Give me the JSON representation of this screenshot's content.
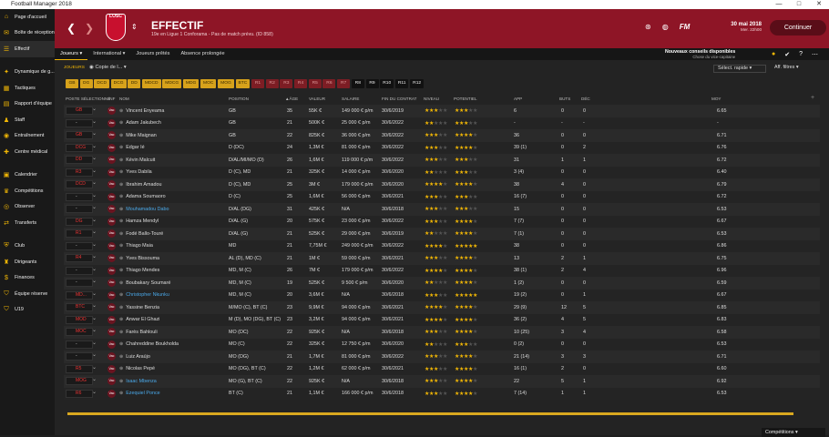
{
  "window": {
    "title": "Football Manager 2018",
    "controls": [
      "—",
      "□",
      "✕"
    ]
  },
  "sidebar": {
    "items": [
      {
        "label": "Page d'accueil",
        "icon": "home-icon",
        "glyph": "⌂"
      },
      {
        "label": "Boîte de réception",
        "icon": "mail-icon",
        "glyph": "✉"
      },
      {
        "label": "Effectif",
        "icon": "squad-icon",
        "glyph": "☰",
        "active": true
      },
      {
        "label": "Dynamique de g...",
        "icon": "dynamics-icon",
        "glyph": "✦"
      },
      {
        "label": "Tactiques",
        "icon": "tactics-icon",
        "glyph": "▦"
      },
      {
        "label": "Rapport d'équipe",
        "icon": "report-icon",
        "glyph": "▤"
      },
      {
        "label": "Staff",
        "icon": "staff-icon",
        "glyph": "♟"
      },
      {
        "label": "Entraînement",
        "icon": "training-icon",
        "glyph": "◉"
      },
      {
        "label": "Centre médical",
        "icon": "medical-icon",
        "glyph": "✚"
      },
      {
        "label": "Calendrier",
        "icon": "calendar-icon",
        "glyph": "▣"
      },
      {
        "label": "Compétitions",
        "icon": "trophy-icon",
        "glyph": "♛"
      },
      {
        "label": "Observer",
        "icon": "scout-icon",
        "glyph": "◎"
      },
      {
        "label": "Transferts",
        "icon": "transfer-icon",
        "glyph": "⇄"
      },
      {
        "label": "Club",
        "icon": "club-icon",
        "glyph": "⛨"
      },
      {
        "label": "Dirigeants",
        "icon": "board-icon",
        "glyph": "♜"
      },
      {
        "label": "Finances",
        "icon": "finance-icon",
        "glyph": "$"
      },
      {
        "label": "Équipe réserve",
        "icon": "reserve-icon",
        "glyph": "⛉"
      },
      {
        "label": "U19",
        "icon": "youth-icon",
        "glyph": "⛉"
      }
    ]
  },
  "header": {
    "crest_text": "LOSC",
    "title": "EFFECTIF",
    "subtitle": "19e en Ligue 1 Conforama - Pas de match prévu. (ID 858)",
    "date": "30 mai 2018",
    "time": "Mer. 22h00",
    "continue_label": "Continuer",
    "advice_title": "Nouveaux conseils disponibles",
    "advice_sub": "Chose du vice-capitaine"
  },
  "subnav": {
    "tabs": [
      "Joueurs ▾",
      "International ▾",
      "Joueurs prêtés",
      "Absence prolongée"
    ]
  },
  "controls": {
    "players_label": "JOUEURS",
    "view_select": "Copie de l...",
    "quick_select": "Sélect. rapide",
    "filter_label": "Aff. filtres"
  },
  "chips": [
    {
      "t": "GB",
      "c": "y"
    },
    {
      "t": "DG",
      "c": "y"
    },
    {
      "t": "DCD",
      "c": "y"
    },
    {
      "t": "DCG",
      "c": "y"
    },
    {
      "t": "DD",
      "c": "y"
    },
    {
      "t": "MDCD",
      "c": "y"
    },
    {
      "t": "MDCG",
      "c": "y"
    },
    {
      "t": "MDG",
      "c": "y"
    },
    {
      "t": "MOC",
      "c": "y"
    },
    {
      "t": "MOG",
      "c": "y"
    },
    {
      "t": "BTC",
      "c": "y"
    },
    {
      "t": "R1",
      "c": "r"
    },
    {
      "t": "R2",
      "c": "r"
    },
    {
      "t": "R3",
      "c": "r"
    },
    {
      "t": "R4",
      "c": "r"
    },
    {
      "t": "R5",
      "c": "r"
    },
    {
      "t": "R6",
      "c": "r"
    },
    {
      "t": "R7",
      "c": "r"
    },
    {
      "t": "R8",
      "c": "k"
    },
    {
      "t": "R9",
      "c": "k"
    },
    {
      "t": "R10",
      "c": "k"
    },
    {
      "t": "R11",
      "c": "k"
    },
    {
      "t": "R12",
      "c": "k"
    }
  ],
  "columns": [
    "POSTE SÉLECTIONNÉ",
    "INF",
    "NOM",
    "POSITION",
    "▲ÂGE",
    "VALEUR",
    "SALAIRE",
    "FIN DU CONTRAT",
    "NIVEAU",
    "POTENTIEL",
    "APP",
    "BUTS",
    "DÉC",
    "MOY"
  ],
  "players": [
    {
      "sel": "GB",
      "name": "Vincent Enyeama",
      "pos": "GB",
      "age": "35",
      "value": "55K €",
      "wage": "149 000 € p/m",
      "contract": "30/6/2019",
      "lvl": 2.5,
      "pot": 2.5,
      "app": "6",
      "goals": "0",
      "dec": "0",
      "avg": "6.65"
    },
    {
      "sel": "-",
      "name": "Adam Jakubech",
      "pos": "GB",
      "age": "21",
      "value": "500K €",
      "wage": "25 000 € p/m",
      "contract": "30/6/2022",
      "lvl": 2,
      "pot": 3,
      "app": "-",
      "goals": "-",
      "dec": "-",
      "avg": "-"
    },
    {
      "sel": "GB",
      "name": "Mike Maignan",
      "pos": "GB",
      "age": "22",
      "value": "825K €",
      "wage": "36 000 € p/m",
      "contract": "30/6/2022",
      "lvl": 2.5,
      "pot": 4,
      "app": "36",
      "goals": "0",
      "dec": "0",
      "avg": "6.71"
    },
    {
      "sel": "DCG",
      "name": "Edgar Ié",
      "pos": "D (DC)",
      "age": "24",
      "value": "1,3M €",
      "wage": "81 000 € p/m",
      "contract": "30/6/2022",
      "lvl": 3,
      "pot": 3.5,
      "app": "39 (1)",
      "goals": "0",
      "dec": "2",
      "avg": "6.76"
    },
    {
      "sel": "DD",
      "name": "Kévin Malcuit",
      "pos": "D/AL/MI/MO (D)",
      "age": "26",
      "value": "1,6M €",
      "wage": "119 000 € p/m",
      "contract": "30/6/2022",
      "lvl": 3,
      "pot": 3,
      "app": "31",
      "goals": "1",
      "dec": "1",
      "avg": "6.72"
    },
    {
      "sel": "R3",
      "name": "Yves Dabila",
      "pos": "D (C), MD",
      "age": "21",
      "value": "325K €",
      "wage": "14 000 € p/m",
      "contract": "30/6/2020",
      "lvl": 2,
      "pot": 3,
      "app": "3 (4)",
      "goals": "0",
      "dec": "0",
      "avg": "6.40"
    },
    {
      "sel": "DCD",
      "name": "Ibrahim Amadou",
      "pos": "D (C), MD",
      "age": "25",
      "value": "3M €",
      "wage": "179 000 € p/m",
      "contract": "30/6/2020",
      "lvl": 3.5,
      "pot": 3.5,
      "app": "38",
      "goals": "4",
      "dec": "0",
      "avg": "6.79"
    },
    {
      "sel": "-",
      "name": "Adama Soumaoro",
      "pos": "D (C)",
      "age": "25",
      "value": "1,6M €",
      "wage": "56 000 € p/m",
      "contract": "30/6/2021",
      "lvl": 3,
      "pot": 3,
      "app": "16 (7)",
      "goals": "0",
      "dec": "0",
      "avg": "6.72"
    },
    {
      "sel": "-",
      "name": "Mouhamadou Dabo",
      "pos": "D/AL (DG)",
      "age": "31",
      "value": "425K €",
      "wage": "N/A",
      "contract": "30/6/2018",
      "lvl": 2.5,
      "pot": 2.5,
      "app": "15",
      "goals": "0",
      "dec": "0",
      "avg": "6.53",
      "loan": true
    },
    {
      "sel": "DG",
      "name": "Hamza Mendyl",
      "pos": "D/AL (G)",
      "age": "20",
      "value": "575K €",
      "wage": "23 000 € p/m",
      "contract": "30/6/2022",
      "lvl": 2.5,
      "pot": 4,
      "app": "7 (7)",
      "goals": "0",
      "dec": "0",
      "avg": "6.67"
    },
    {
      "sel": "R1",
      "name": "Fodé Ballo-Touré",
      "pos": "D/AL (G)",
      "age": "21",
      "value": "525K €",
      "wage": "29 000 € p/m",
      "contract": "30/6/2019",
      "lvl": 2,
      "pot": 3.5,
      "app": "7 (1)",
      "goals": "0",
      "dec": "0",
      "avg": "6.53"
    },
    {
      "sel": "-",
      "name": "Thiago Maia",
      "pos": "MD",
      "age": "21",
      "value": "7,75M €",
      "wage": "249 000 € p/m",
      "contract": "30/6/2022",
      "lvl": 3.5,
      "pot": 4.5,
      "app": "38",
      "goals": "0",
      "dec": "0",
      "avg": "6.86"
    },
    {
      "sel": "R4",
      "name": "Yves Bissouma",
      "pos": "AL (D), MD (C)",
      "age": "21",
      "value": "1M €",
      "wage": "59 000 € p/m",
      "contract": "30/6/2021",
      "lvl": 3,
      "pot": 4,
      "app": "13",
      "goals": "2",
      "dec": "1",
      "avg": "6.75"
    },
    {
      "sel": "-",
      "name": "Thiago Mendes",
      "pos": "MD, M (C)",
      "age": "26",
      "value": "7M €",
      "wage": "179 000 € p/m",
      "contract": "30/6/2022",
      "lvl": 4,
      "pot": 4,
      "app": "38 (1)",
      "goals": "2",
      "dec": "4",
      "avg": "6.96"
    },
    {
      "sel": "-",
      "name": "Boubakary Soumaré",
      "pos": "MD, M (C)",
      "age": "19",
      "value": "525K €",
      "wage": "9 500 € p/m",
      "contract": "30/6/2020",
      "lvl": 2,
      "pot": 4,
      "app": "1 (2)",
      "goals": "0",
      "dec": "0",
      "avg": "6.59"
    },
    {
      "sel": "MD...",
      "name": "Christopher Nkunku",
      "pos": "MD, M (C)",
      "age": "20",
      "value": "3,6M €",
      "wage": "N/A",
      "contract": "30/6/2018",
      "lvl": 3,
      "pot": 4.5,
      "app": "19 (2)",
      "goals": "0",
      "dec": "1",
      "avg": "6.67",
      "loan": true
    },
    {
      "sel": "BTC",
      "name": "Yassine Benzia",
      "pos": "M/MO (C), BT (C)",
      "age": "23",
      "value": "9,9M €",
      "wage": "94 000 € p/m",
      "contract": "30/6/2021",
      "lvl": 3.5,
      "pot": 4,
      "app": "29 (9)",
      "goals": "12",
      "dec": "5",
      "avg": "6.85"
    },
    {
      "sel": "MOD",
      "name": "Anwar El Ghazi",
      "pos": "M (D), MO (DG), BT (C)",
      "age": "23",
      "value": "3,2M €",
      "wage": "94 000 € p/m",
      "contract": "30/6/2021",
      "lvl": 3.5,
      "pot": 3.5,
      "app": "36 (2)",
      "goals": "4",
      "dec": "5",
      "avg": "6.83"
    },
    {
      "sel": "MOC",
      "name": "Farès Bahlouli",
      "pos": "MO (DC)",
      "age": "22",
      "value": "925K €",
      "wage": "N/A",
      "contract": "30/6/2018",
      "lvl": 2.5,
      "pot": 3.5,
      "app": "10 (25)",
      "goals": "3",
      "dec": "4",
      "avg": "6.58"
    },
    {
      "sel": "-",
      "name": "Chahreddine Boukholda",
      "pos": "MO (C)",
      "age": "22",
      "value": "325K €",
      "wage": "12 750 € p/m",
      "contract": "30/6/2020",
      "lvl": 2,
      "pot": 3,
      "app": "0 (2)",
      "goals": "0",
      "dec": "0",
      "avg": "6.53"
    },
    {
      "sel": "-",
      "name": "Luiz Araújo",
      "pos": "MO (DG)",
      "age": "21",
      "value": "1,7M €",
      "wage": "81 000 € p/m",
      "contract": "30/6/2022",
      "lvl": 3,
      "pot": 4,
      "app": "21 (14)",
      "goals": "3",
      "dec": "3",
      "avg": "6.71"
    },
    {
      "sel": "R5",
      "name": "Nicolas Pepé",
      "pos": "MO (DG), BT (C)",
      "age": "22",
      "value": "1,2M €",
      "wage": "62 000 € p/m",
      "contract": "30/6/2021",
      "lvl": 3,
      "pot": 3.5,
      "app": "16 (1)",
      "goals": "2",
      "dec": "0",
      "avg": "6.60"
    },
    {
      "sel": "MOG",
      "name": "Isaac Mbenza",
      "pos": "MO (G), BT (C)",
      "age": "22",
      "value": "925K €",
      "wage": "N/A",
      "contract": "30/6/2018",
      "lvl": 2.5,
      "pot": 3.5,
      "app": "22",
      "goals": "5",
      "dec": "1",
      "avg": "6.92",
      "loan": true
    },
    {
      "sel": "R6",
      "name": "Ezequiel Ponce",
      "pos": "BT (C)",
      "age": "21",
      "value": "1,1M €",
      "wage": "166 000 € p/m",
      "contract": "30/6/2018",
      "lvl": 2.5,
      "pot": 3.5,
      "app": "7 (14)",
      "goals": "1",
      "dec": "1",
      "avg": "6.53",
      "loan": true
    }
  ],
  "footer": {
    "competitions_label": "Compétitions ▾"
  }
}
